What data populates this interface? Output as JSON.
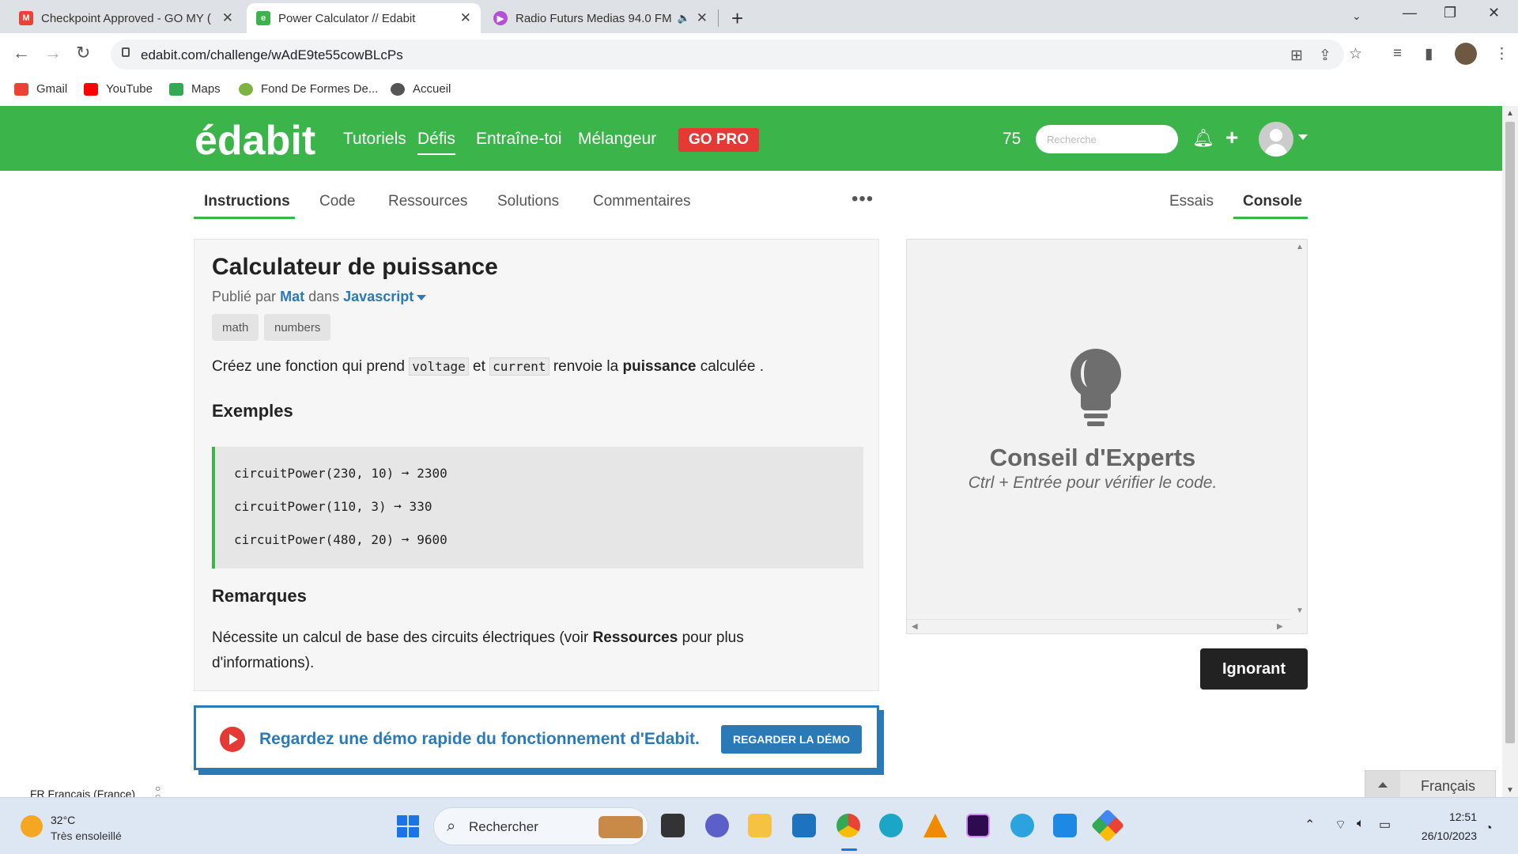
{
  "browser": {
    "tabs": [
      {
        "title": "Checkpoint Approved - GO MY (",
        "favicon": "gmail-icon"
      },
      {
        "title": "Power Calculator // Edabit",
        "favicon": "edabit-icon"
      },
      {
        "title": "Radio Futurs Medias 94.0 FM",
        "favicon": "radio-icon"
      }
    ],
    "url": "edabit.com/challenge/wAdE9te55cowBLcPs",
    "bookmarks": [
      "Gmail",
      "YouTube",
      "Maps",
      "Fond De Formes De...",
      "Accueil"
    ]
  },
  "edabit": {
    "logo": "édabit",
    "nav": [
      "Tutoriels",
      "Défis",
      "Entraîne-toi",
      "Mélangeur"
    ],
    "gopro": "GO PRO",
    "points": "75",
    "search_placeholder": "Recherche",
    "subtabs_left": [
      "Instructions",
      "Code",
      "Ressources",
      "Solutions",
      "Commentaires"
    ],
    "subtabs_right": [
      "Essais",
      "Console"
    ],
    "more": "•••",
    "challenge": {
      "title": "Calculateur de puissance",
      "published_by": "Publié par",
      "author": "Mat",
      "in": "dans",
      "language": "Javascript",
      "tags": [
        "math",
        "numbers"
      ],
      "desc": {
        "p1": "Créez une fonction qui prend ",
        "code1": "voltage",
        "p2": " et ",
        "code2": "current",
        "p3": " renvoie la ",
        "bold": "puissance",
        "p4": " calculée ."
      },
      "examples_heading": "Exemples",
      "examples": [
        "circuitPower(230, 10) ➞ 2300",
        "circuitPower(110, 3) ➞ 330",
        "circuitPower(480, 20) ➞ 9600"
      ],
      "notes_heading": "Remarques",
      "notes": {
        "p1": "Nécessite un calcul de base des circuits électriques (voir ",
        "bold": "Ressources",
        "p2": " pour plus d'informations)."
      }
    },
    "demo": {
      "text": "Regardez une démo rapide du fonctionnement d'Edabit.",
      "button": "REGARDER LA DÉMO"
    },
    "console": {
      "tip_title": "Conseil d'Experts",
      "tip_sub": "Ctrl + Entrée pour vérifier le code."
    },
    "ignore_button": "Ignorant",
    "language_select": "Français",
    "colors": {
      "brand": "#3bb54a",
      "link": "#2a7ab8",
      "gopro": "#e53935"
    }
  },
  "ime": "FR Français (France)",
  "taskbar": {
    "temp": "32°C",
    "weather": "Très ensoleillé",
    "search": "Rechercher",
    "time": "12:51",
    "date": "26/10/2023"
  }
}
